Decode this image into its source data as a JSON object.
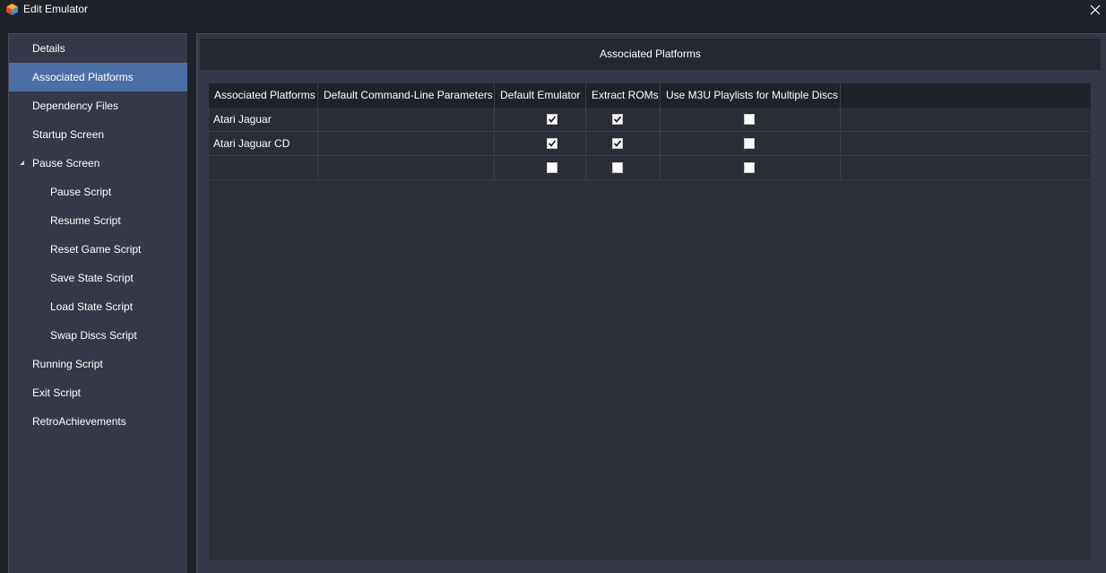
{
  "window": {
    "title": "Edit Emulator",
    "app_icon": "app-icon",
    "close_icon": "close-icon"
  },
  "sidebar": {
    "items": [
      {
        "label": "Details",
        "level": 0,
        "selected": false
      },
      {
        "label": "Associated Platforms",
        "level": 0,
        "selected": true
      },
      {
        "label": "Dependency Files",
        "level": 0,
        "selected": false
      },
      {
        "label": "Startup Screen",
        "level": 0,
        "selected": false
      },
      {
        "label": "Pause Screen",
        "level": 0,
        "selected": false,
        "expanded": true
      },
      {
        "label": "Pause Script",
        "level": 1,
        "selected": false
      },
      {
        "label": "Resume Script",
        "level": 1,
        "selected": false
      },
      {
        "label": "Reset Game Script",
        "level": 1,
        "selected": false
      },
      {
        "label": "Save State Script",
        "level": 1,
        "selected": false
      },
      {
        "label": "Load State Script",
        "level": 1,
        "selected": false
      },
      {
        "label": "Swap Discs Script",
        "level": 1,
        "selected": false
      },
      {
        "label": "Running Script",
        "level": 0,
        "selected": false
      },
      {
        "label": "Exit Script",
        "level": 0,
        "selected": false
      },
      {
        "label": "RetroAchievements",
        "level": 0,
        "selected": false
      }
    ]
  },
  "main": {
    "section_title": "Associated Platforms",
    "table": {
      "columns": [
        "Associated Platforms",
        "Default Command-Line Parameters",
        "Default Emulator",
        "Extract ROMs",
        "Use M3U Playlists for Multiple Discs"
      ],
      "rows": [
        {
          "platform": "Atari Jaguar",
          "params": "",
          "default_emulator": true,
          "extract_roms": true,
          "use_m3u": false
        },
        {
          "platform": "Atari Jaguar CD",
          "params": "",
          "default_emulator": true,
          "extract_roms": true,
          "use_m3u": false
        },
        {
          "platform": "",
          "params": "",
          "default_emulator": false,
          "extract_roms": false,
          "use_m3u": false
        }
      ]
    }
  },
  "colors": {
    "background": "#1f2129",
    "panel": "#353846",
    "selected": "#4c6ea6",
    "grid": "#2c2e38",
    "grid_header": "#20222a"
  }
}
